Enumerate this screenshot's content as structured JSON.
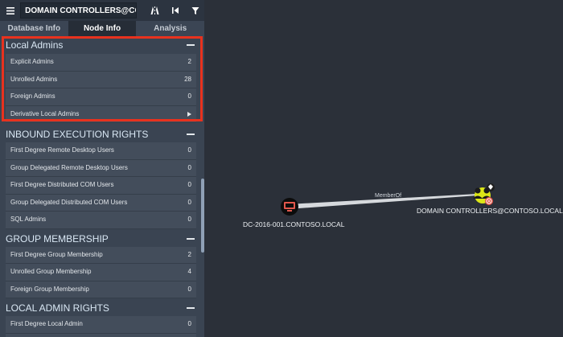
{
  "topbar": {
    "search_value": "DOMAIN CONTROLLERS@CONTOSO.LOCAL",
    "icons": [
      "menu-icon",
      "pathfinding-icon",
      "back-icon",
      "filter-icon"
    ]
  },
  "tabs": [
    {
      "label": "Database Info",
      "active": false
    },
    {
      "label": "Node Info",
      "active": true
    },
    {
      "label": "Analysis",
      "active": false
    }
  ],
  "sections": [
    {
      "title": "Local Admins",
      "rows": [
        {
          "label": "Explicit Admins",
          "value": "2"
        },
        {
          "label": "Unrolled Admins",
          "value": "28"
        },
        {
          "label": "Foreign Admins",
          "value": "0"
        },
        {
          "label": "Derivative Local Admins",
          "value": ""
        }
      ]
    },
    {
      "title": "INBOUND EXECUTION RIGHTS",
      "rows": [
        {
          "label": "First Degree Remote Desktop Users",
          "value": "0"
        },
        {
          "label": "Group Delegated Remote Desktop Users",
          "value": "0"
        },
        {
          "label": "First Degree Distributed COM Users",
          "value": "0"
        },
        {
          "label": "Group Delegated Distributed COM Users",
          "value": "0"
        },
        {
          "label": "SQL Admins",
          "value": "0"
        }
      ]
    },
    {
      "title": "GROUP MEMBERSHIP",
      "rows": [
        {
          "label": "First Degree Group Membership",
          "value": "2"
        },
        {
          "label": "Unrolled Group Membership",
          "value": "4"
        },
        {
          "label": "Foreign Group Membership",
          "value": "0"
        }
      ]
    },
    {
      "title": "LOCAL ADMIN RIGHTS",
      "rows": [
        {
          "label": "First Degree Local Admin",
          "value": "0"
        }
      ]
    }
  ],
  "graph": {
    "nodes": [
      {
        "label": "DC-2016-001.CONTOSO.LOCAL",
        "type": "computer",
        "icon": "computer-icon",
        "color": "#e2574c"
      },
      {
        "label": "DOMAIN CONTROLLERS@CONTOSO.LOCAL",
        "type": "group",
        "icon": "group-icon",
        "color": "#dbe617"
      }
    ],
    "edge": {
      "label": "MemberOf"
    }
  },
  "colors": {
    "panel": "#3a4452",
    "background": "#2b3039",
    "highlight": "#e8321e"
  }
}
